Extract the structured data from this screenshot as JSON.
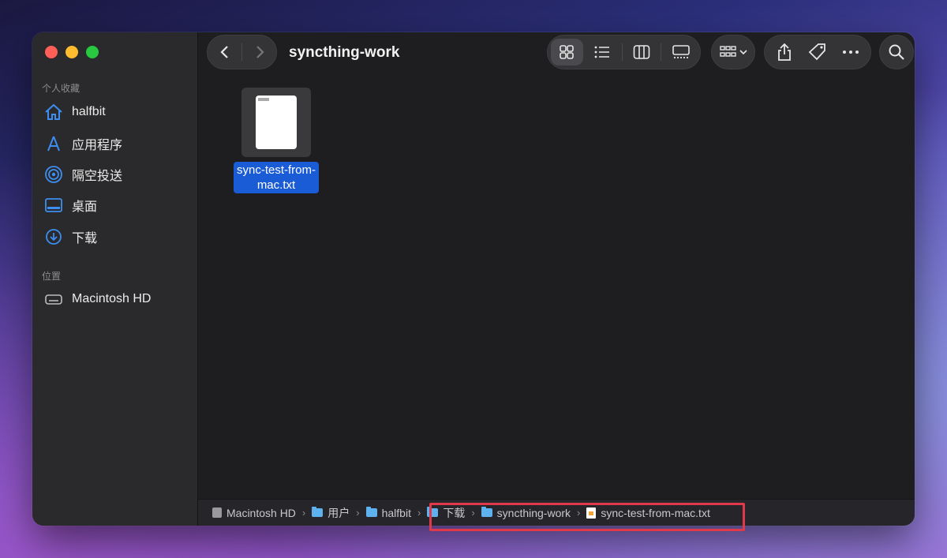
{
  "window": {
    "title": "syncthing-work"
  },
  "sidebar": {
    "favorites_header": "个人收藏",
    "favorites": [
      {
        "label": "halfbit",
        "icon": "home-icon"
      },
      {
        "label": "应用程序",
        "icon": "applications-icon"
      },
      {
        "label": "隔空投送",
        "icon": "airdrop-icon"
      },
      {
        "label": "桌面",
        "icon": "desktop-icon"
      },
      {
        "label": "下载",
        "icon": "downloads-icon"
      }
    ],
    "locations_header": "位置",
    "locations": [
      {
        "label": "Macintosh HD",
        "icon": "disk-icon"
      }
    ]
  },
  "files": [
    {
      "name": "sync-test-from-mac.txt",
      "name_line1": "sync-test-from-",
      "name_line2": "mac.txt",
      "selected": true
    }
  ],
  "pathbar": {
    "crumbs": [
      {
        "label": "Macintosh HD",
        "icon": "disk-icon"
      },
      {
        "label": "用户",
        "icon": "folder-icon"
      },
      {
        "label": "halfbit",
        "icon": "folder-icon"
      },
      {
        "label": "下载",
        "icon": "folder-icon"
      },
      {
        "label": "syncthing-work",
        "icon": "folder-icon"
      },
      {
        "label": "sync-test-from-mac.txt",
        "icon": "text-file-icon"
      }
    ]
  },
  "colors": {
    "accent": "#1a5cd6",
    "highlight_border": "#e03a4a",
    "folder": "#5fb2f0",
    "sidebar_icon": "#3d8ef0"
  }
}
